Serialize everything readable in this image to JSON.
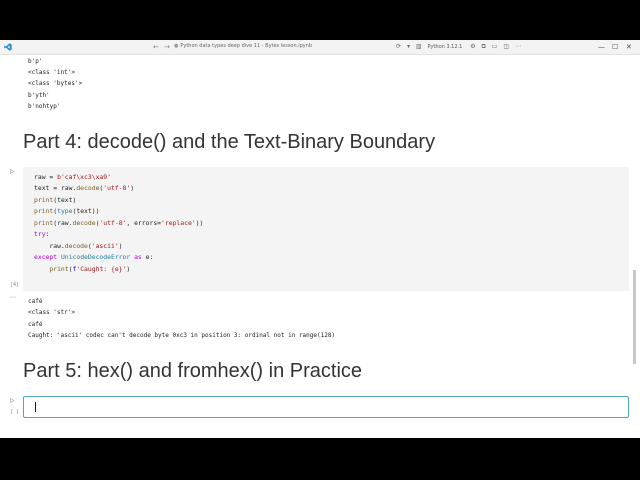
{
  "window": {
    "title": "Python data types deep dive 11 - Bytes lesson.ipynb",
    "kernel": "Python 3.12.1"
  },
  "outputs_top": [
    "b'p'",
    "<class 'int'>",
    "<class 'bytes'>",
    "b'yth'",
    "b'nohtyp'"
  ],
  "headings": {
    "part4": "Part 4: decode() and the Text-Binary Boundary",
    "part5": "Part 5: hex() and fromhex() in Practice"
  },
  "code_cell": {
    "execution_count": "[4]",
    "lines": [
      "raw = b'caf\\xc3\\xa9'",
      "text = raw.decode('utf-8')",
      "print(text)",
      "print(type(text))",
      "print(raw.decode('utf-8', errors='replace'))",
      "try:",
      "    raw.decode('ascii')",
      "except UnicodeDecodeError as e:",
      "    print(f'Caught: {e}')"
    ]
  },
  "code_output": [
    "café",
    "<class 'str'>",
    "café",
    "Caught: 'ascii' codec can't decode byte 0xc3 in position 3: ordinal not in range(128)"
  ],
  "empty_cell": {
    "execution_count": "[ ]"
  }
}
